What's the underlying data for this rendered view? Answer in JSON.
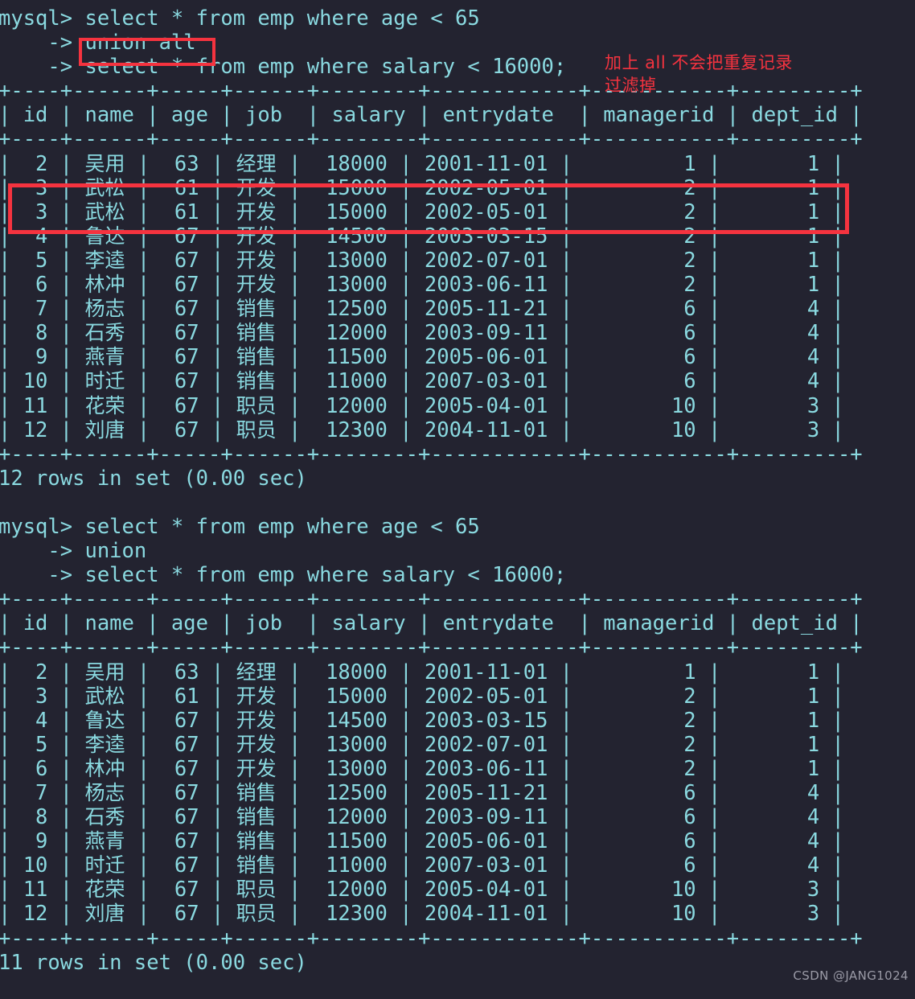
{
  "terminal": {
    "prompt": "mysql>",
    "continuation": "    ->",
    "background_color": "#232330",
    "text_color": "#8ad9e0",
    "accent_color": "#f5333f"
  },
  "blocks": [
    {
      "name": "union-all-query",
      "query_lines": [
        "mysql> select * from emp where age < 65",
        "    -> union all",
        "    -> select * from emp where salary < 16000;"
      ],
      "columns": [
        "id",
        "name",
        "age",
        "job",
        "salary",
        "entrydate",
        "managerid",
        "dept_id"
      ],
      "rows": [
        [
          "2",
          "吴用",
          "63",
          "经理",
          "18000",
          "2001-11-01",
          "1",
          "1"
        ],
        [
          "3",
          "武松",
          "61",
          "开发",
          "15000",
          "2002-05-01",
          "2",
          "1"
        ],
        [
          "3",
          "武松",
          "61",
          "开发",
          "15000",
          "2002-05-01",
          "2",
          "1"
        ],
        [
          "4",
          "鲁达",
          "67",
          "开发",
          "14500",
          "2003-03-15",
          "2",
          "1"
        ],
        [
          "5",
          "李逵",
          "67",
          "开发",
          "13000",
          "2002-07-01",
          "2",
          "1"
        ],
        [
          "6",
          "林冲",
          "67",
          "开发",
          "13000",
          "2003-06-11",
          "2",
          "1"
        ],
        [
          "7",
          "杨志",
          "67",
          "销售",
          "12500",
          "2005-11-21",
          "6",
          "4"
        ],
        [
          "8",
          "石秀",
          "67",
          "销售",
          "12000",
          "2003-09-11",
          "6",
          "4"
        ],
        [
          "9",
          "燕青",
          "67",
          "销售",
          "11500",
          "2005-06-01",
          "6",
          "4"
        ],
        [
          "10",
          "时迁",
          "67",
          "销售",
          "11000",
          "2007-03-01",
          "6",
          "4"
        ],
        [
          "11",
          "花荣",
          "67",
          "职员",
          "12000",
          "2005-04-01",
          "10",
          "3"
        ],
        [
          "12",
          "刘唐",
          "67",
          "职员",
          "12300",
          "2004-11-01",
          "10",
          "3"
        ]
      ],
      "status": "12 rows in set (0.00 sec)"
    },
    {
      "name": "union-query",
      "query_lines": [
        "mysql> select * from emp where age < 65",
        "    -> union",
        "    -> select * from emp where salary < 16000;"
      ],
      "columns": [
        "id",
        "name",
        "age",
        "job",
        "salary",
        "entrydate",
        "managerid",
        "dept_id"
      ],
      "rows": [
        [
          "2",
          "吴用",
          "63",
          "经理",
          "18000",
          "2001-11-01",
          "1",
          "1"
        ],
        [
          "3",
          "武松",
          "61",
          "开发",
          "15000",
          "2002-05-01",
          "2",
          "1"
        ],
        [
          "4",
          "鲁达",
          "67",
          "开发",
          "14500",
          "2003-03-15",
          "2",
          "1"
        ],
        [
          "5",
          "李逵",
          "67",
          "开发",
          "13000",
          "2002-07-01",
          "2",
          "1"
        ],
        [
          "6",
          "林冲",
          "67",
          "开发",
          "13000",
          "2003-06-11",
          "2",
          "1"
        ],
        [
          "7",
          "杨志",
          "67",
          "销售",
          "12500",
          "2005-11-21",
          "6",
          "4"
        ],
        [
          "8",
          "石秀",
          "67",
          "销售",
          "12000",
          "2003-09-11",
          "6",
          "4"
        ],
        [
          "9",
          "燕青",
          "67",
          "销售",
          "11500",
          "2005-06-01",
          "6",
          "4"
        ],
        [
          "10",
          "时迁",
          "67",
          "销售",
          "11000",
          "2007-03-01",
          "6",
          "4"
        ],
        [
          "11",
          "花荣",
          "67",
          "职员",
          "12000",
          "2005-04-01",
          "10",
          "3"
        ],
        [
          "12",
          "刘唐",
          "67",
          "职员",
          "12300",
          "2004-11-01",
          "10",
          "3"
        ]
      ],
      "status": "11 rows in set (0.00 sec)"
    }
  ],
  "annotations": {
    "note_text": "加上 all 不会把重复记录\n过滤掉",
    "highlight_keyword": "union all",
    "highlight_rows_label": "duplicate-rows-highlight"
  },
  "watermark": "CSDN @JANG1024"
}
